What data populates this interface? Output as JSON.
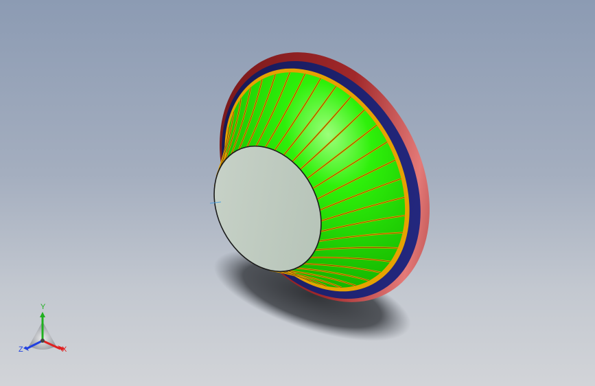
{
  "viewport": {
    "background_top": "#8c9bb3",
    "background_bottom": "#d2d4d8"
  },
  "model": {
    "rim_color": "#a0282a",
    "rim_edge_color": "#1c1f6e",
    "fin_color": "#22e400",
    "fin_edge_color": "#e7a300",
    "face_color": "#bfcbbf",
    "fin_count": 36
  },
  "triad": {
    "x_label": "X",
    "y_label": "Y",
    "z_label": "Z",
    "x_color": "#e02020",
    "y_color": "#20b020",
    "z_color": "#2040e0"
  }
}
